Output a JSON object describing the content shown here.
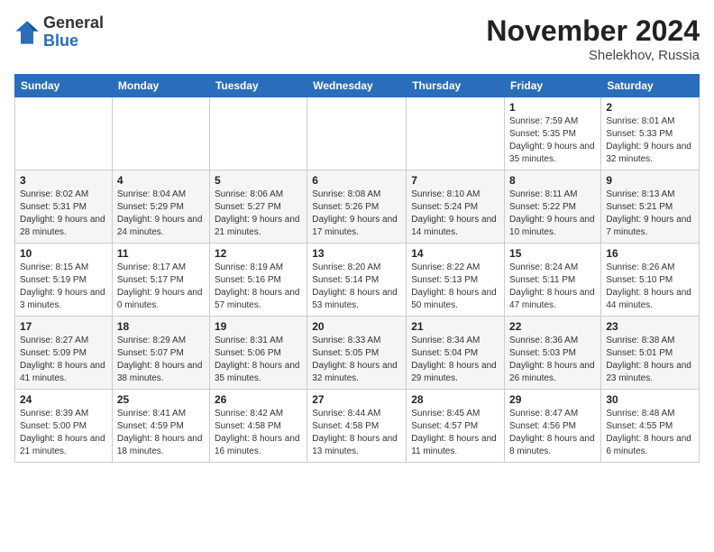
{
  "header": {
    "logo_general": "General",
    "logo_blue": "Blue",
    "month_year": "November 2024",
    "location": "Shelekhov, Russia"
  },
  "weekdays": [
    "Sunday",
    "Monday",
    "Tuesday",
    "Wednesday",
    "Thursday",
    "Friday",
    "Saturday"
  ],
  "weeks": [
    [
      {
        "day": "",
        "info": ""
      },
      {
        "day": "",
        "info": ""
      },
      {
        "day": "",
        "info": ""
      },
      {
        "day": "",
        "info": ""
      },
      {
        "day": "",
        "info": ""
      },
      {
        "day": "1",
        "info": "Sunrise: 7:59 AM\nSunset: 5:35 PM\nDaylight: 9 hours and 35 minutes."
      },
      {
        "day": "2",
        "info": "Sunrise: 8:01 AM\nSunset: 5:33 PM\nDaylight: 9 hours and 32 minutes."
      }
    ],
    [
      {
        "day": "3",
        "info": "Sunrise: 8:02 AM\nSunset: 5:31 PM\nDaylight: 9 hours and 28 minutes."
      },
      {
        "day": "4",
        "info": "Sunrise: 8:04 AM\nSunset: 5:29 PM\nDaylight: 9 hours and 24 minutes."
      },
      {
        "day": "5",
        "info": "Sunrise: 8:06 AM\nSunset: 5:27 PM\nDaylight: 9 hours and 21 minutes."
      },
      {
        "day": "6",
        "info": "Sunrise: 8:08 AM\nSunset: 5:26 PM\nDaylight: 9 hours and 17 minutes."
      },
      {
        "day": "7",
        "info": "Sunrise: 8:10 AM\nSunset: 5:24 PM\nDaylight: 9 hours and 14 minutes."
      },
      {
        "day": "8",
        "info": "Sunrise: 8:11 AM\nSunset: 5:22 PM\nDaylight: 9 hours and 10 minutes."
      },
      {
        "day": "9",
        "info": "Sunrise: 8:13 AM\nSunset: 5:21 PM\nDaylight: 9 hours and 7 minutes."
      }
    ],
    [
      {
        "day": "10",
        "info": "Sunrise: 8:15 AM\nSunset: 5:19 PM\nDaylight: 9 hours and 3 minutes."
      },
      {
        "day": "11",
        "info": "Sunrise: 8:17 AM\nSunset: 5:17 PM\nDaylight: 9 hours and 0 minutes."
      },
      {
        "day": "12",
        "info": "Sunrise: 8:19 AM\nSunset: 5:16 PM\nDaylight: 8 hours and 57 minutes."
      },
      {
        "day": "13",
        "info": "Sunrise: 8:20 AM\nSunset: 5:14 PM\nDaylight: 8 hours and 53 minutes."
      },
      {
        "day": "14",
        "info": "Sunrise: 8:22 AM\nSunset: 5:13 PM\nDaylight: 8 hours and 50 minutes."
      },
      {
        "day": "15",
        "info": "Sunrise: 8:24 AM\nSunset: 5:11 PM\nDaylight: 8 hours and 47 minutes."
      },
      {
        "day": "16",
        "info": "Sunrise: 8:26 AM\nSunset: 5:10 PM\nDaylight: 8 hours and 44 minutes."
      }
    ],
    [
      {
        "day": "17",
        "info": "Sunrise: 8:27 AM\nSunset: 5:09 PM\nDaylight: 8 hours and 41 minutes."
      },
      {
        "day": "18",
        "info": "Sunrise: 8:29 AM\nSunset: 5:07 PM\nDaylight: 8 hours and 38 minutes."
      },
      {
        "day": "19",
        "info": "Sunrise: 8:31 AM\nSunset: 5:06 PM\nDaylight: 8 hours and 35 minutes."
      },
      {
        "day": "20",
        "info": "Sunrise: 8:33 AM\nSunset: 5:05 PM\nDaylight: 8 hours and 32 minutes."
      },
      {
        "day": "21",
        "info": "Sunrise: 8:34 AM\nSunset: 5:04 PM\nDaylight: 8 hours and 29 minutes."
      },
      {
        "day": "22",
        "info": "Sunrise: 8:36 AM\nSunset: 5:03 PM\nDaylight: 8 hours and 26 minutes."
      },
      {
        "day": "23",
        "info": "Sunrise: 8:38 AM\nSunset: 5:01 PM\nDaylight: 8 hours and 23 minutes."
      }
    ],
    [
      {
        "day": "24",
        "info": "Sunrise: 8:39 AM\nSunset: 5:00 PM\nDaylight: 8 hours and 21 minutes."
      },
      {
        "day": "25",
        "info": "Sunrise: 8:41 AM\nSunset: 4:59 PM\nDaylight: 8 hours and 18 minutes."
      },
      {
        "day": "26",
        "info": "Sunrise: 8:42 AM\nSunset: 4:58 PM\nDaylight: 8 hours and 16 minutes."
      },
      {
        "day": "27",
        "info": "Sunrise: 8:44 AM\nSunset: 4:58 PM\nDaylight: 8 hours and 13 minutes."
      },
      {
        "day": "28",
        "info": "Sunrise: 8:45 AM\nSunset: 4:57 PM\nDaylight: 8 hours and 11 minutes."
      },
      {
        "day": "29",
        "info": "Sunrise: 8:47 AM\nSunset: 4:56 PM\nDaylight: 8 hours and 8 minutes."
      },
      {
        "day": "30",
        "info": "Sunrise: 8:48 AM\nSunset: 4:55 PM\nDaylight: 8 hours and 6 minutes."
      }
    ]
  ]
}
